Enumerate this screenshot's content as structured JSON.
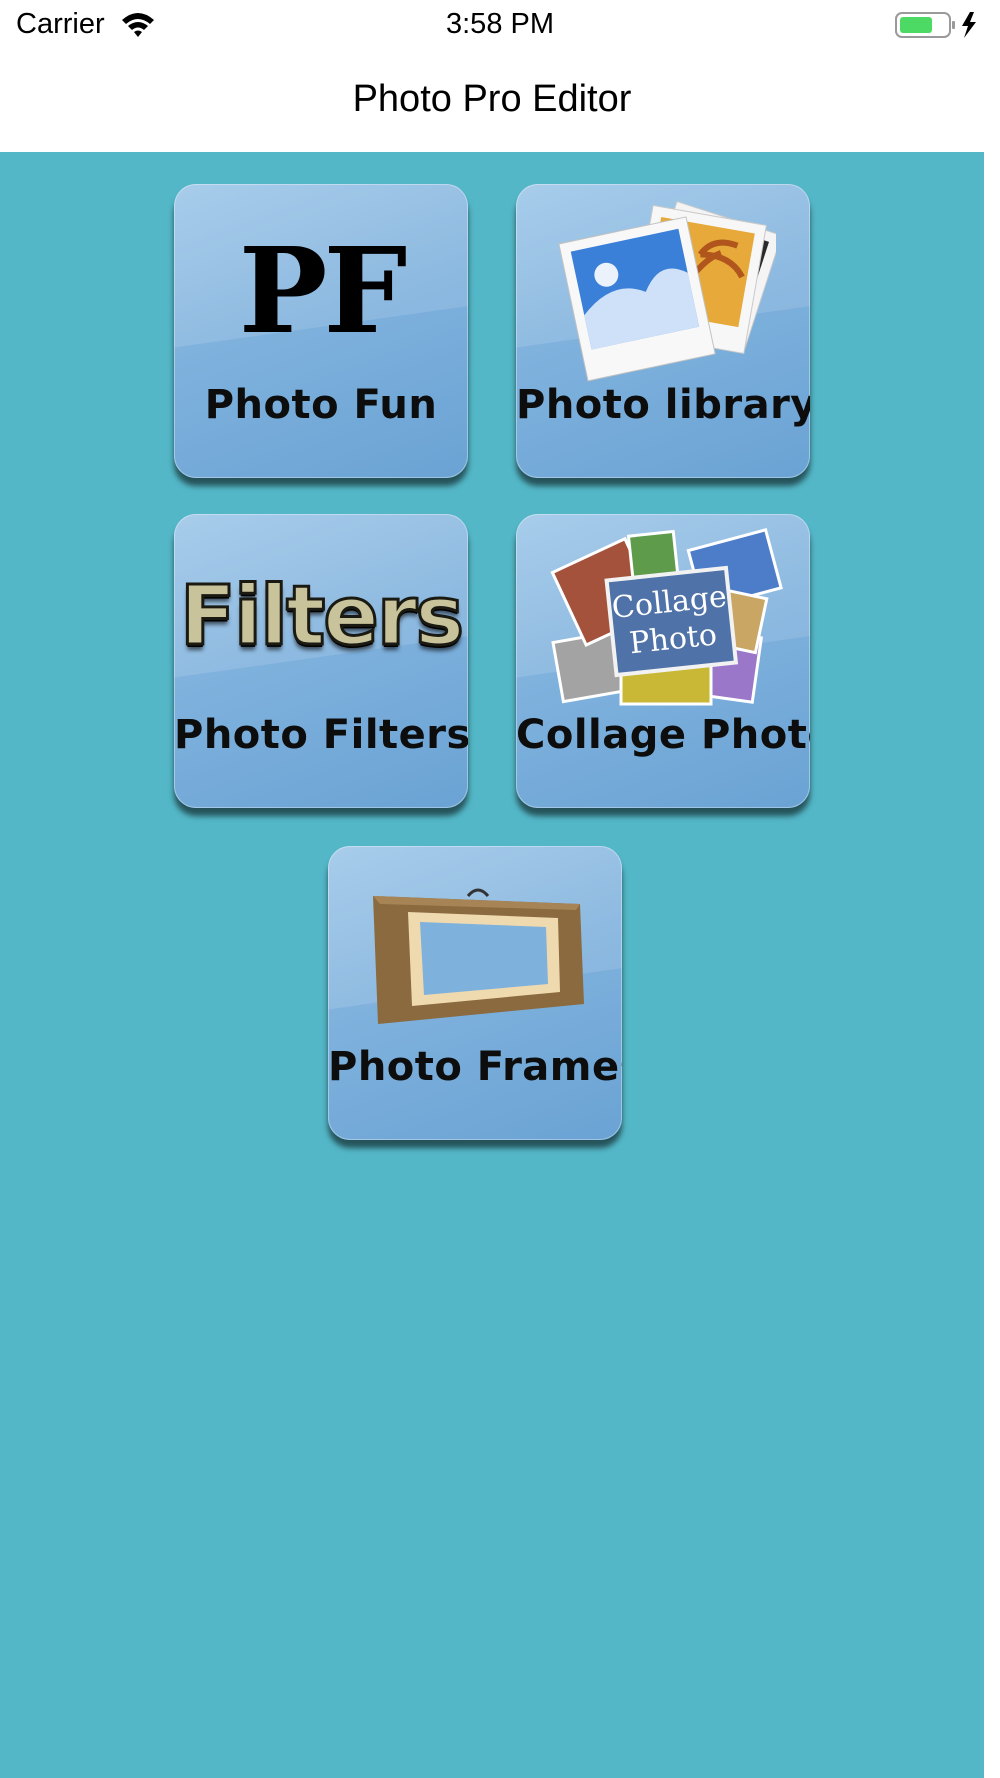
{
  "status_bar": {
    "carrier": "Carrier",
    "time": "3:58 PM",
    "wifi_icon": "wifi-icon",
    "battery_icon": "battery-charging-icon",
    "battery_color": "#4cd964"
  },
  "nav": {
    "title": "Photo Pro Editor"
  },
  "colors": {
    "background": "#53b7c7",
    "tile": "#7fb1dd"
  },
  "tiles": [
    {
      "label": "Photo Fun",
      "logo_text": "PF",
      "icon": "pf-logo-icon"
    },
    {
      "label": "Photo library",
      "icon": "photo-stack-icon"
    },
    {
      "label": "Photo Filters",
      "logo_text": "Filters",
      "icon": "filters-logo-icon"
    },
    {
      "label": "Collage Photo",
      "logo_text": [
        "Collage",
        "Photo"
      ],
      "icon": "collage-icon"
    },
    {
      "label": "Photo Frames",
      "icon": "picture-frame-icon"
    }
  ]
}
